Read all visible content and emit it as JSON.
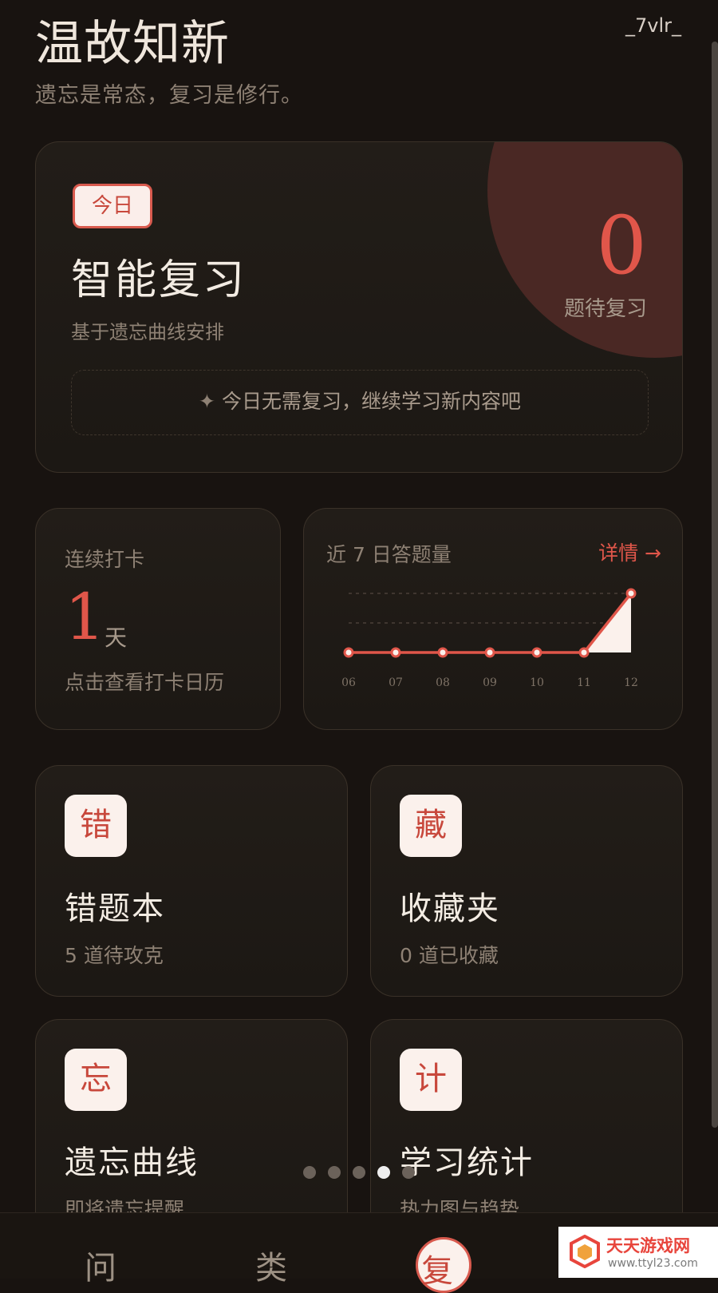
{
  "header": {
    "title": "温故知新",
    "subtitle": "遗忘是常态，复习是修行。",
    "user": "_7vlr_"
  },
  "review": {
    "badge": "今日",
    "title": "智能复习",
    "description": "基于遗忘曲线安排",
    "pending_count": "0",
    "pending_label": "题待复习",
    "tip_icon": "✦",
    "tip": "今日无需复习，继续学习新内容吧"
  },
  "streak": {
    "label": "连续打卡",
    "days": "1",
    "unit": "天",
    "hint": "点击查看打卡日历"
  },
  "weekly": {
    "title": "近 7 日答题量",
    "detail": "详情 →"
  },
  "chart_data": {
    "type": "area",
    "categories": [
      "06",
      "07",
      "08",
      "09",
      "10",
      "11",
      "12"
    ],
    "series": [
      {
        "values": [
          0,
          0,
          0,
          0,
          0,
          0,
          2
        ]
      }
    ],
    "ylim": [
      0,
      2
    ],
    "grid": true,
    "accent": "#e0564a"
  },
  "tiles": [
    {
      "icon": "错",
      "title": "错题本",
      "subtitle": "5 道待攻克"
    },
    {
      "icon": "藏",
      "title": "收藏夹",
      "subtitle": "0 道已收藏"
    },
    {
      "icon": "忘",
      "title": "遗忘曲线",
      "subtitle": "即将遗忘提醒"
    },
    {
      "icon": "计",
      "title": "学习统计",
      "subtitle": "热力图与趋势"
    }
  ],
  "pager": {
    "count": 5,
    "active": 3
  },
  "nav": {
    "ask": "问",
    "category": "类",
    "review": "复"
  },
  "watermark": {
    "name": "天天游戏网",
    "url": "www.ttyl23.com"
  },
  "colors": {
    "accent": "#e0564a",
    "background": "#181310",
    "card": "#201b17"
  }
}
